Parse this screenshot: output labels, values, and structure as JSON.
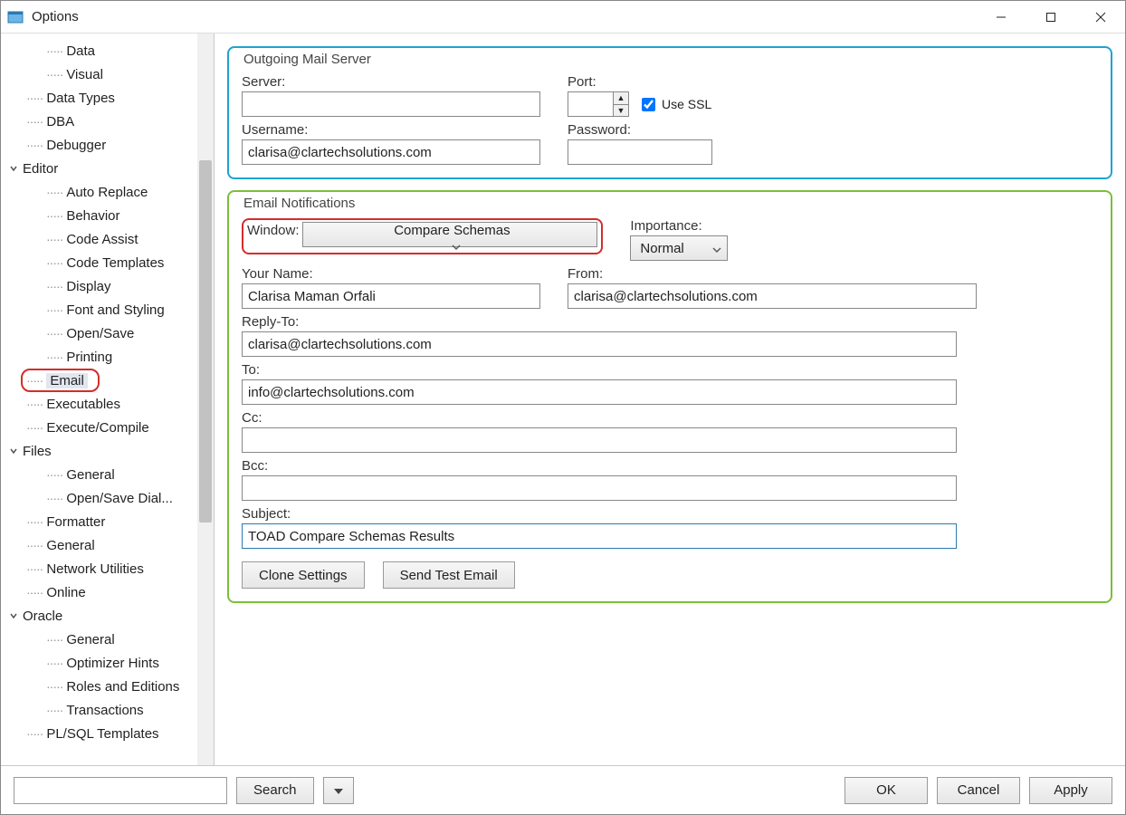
{
  "window": {
    "title": "Options"
  },
  "tree": {
    "items": [
      {
        "label": "Data",
        "indent": 3,
        "expander": ""
      },
      {
        "label": "Visual",
        "indent": 3,
        "expander": ""
      },
      {
        "label": "Data Types",
        "indent": 2,
        "expander": ""
      },
      {
        "label": "DBA",
        "indent": 2,
        "expander": ""
      },
      {
        "label": "Debugger",
        "indent": 2,
        "expander": ""
      },
      {
        "label": "Editor",
        "indent": 1,
        "expander": "open"
      },
      {
        "label": "Auto Replace",
        "indent": 3,
        "expander": ""
      },
      {
        "label": "Behavior",
        "indent": 3,
        "expander": ""
      },
      {
        "label": "Code Assist",
        "indent": 3,
        "expander": ""
      },
      {
        "label": "Code Templates",
        "indent": 3,
        "expander": ""
      },
      {
        "label": "Display",
        "indent": 3,
        "expander": ""
      },
      {
        "label": "Font and Styling",
        "indent": 3,
        "expander": ""
      },
      {
        "label": "Open/Save",
        "indent": 3,
        "expander": ""
      },
      {
        "label": "Printing",
        "indent": 3,
        "expander": ""
      },
      {
        "label": "Email",
        "indent": 2,
        "expander": "",
        "selected": true,
        "redbox": true
      },
      {
        "label": "Executables",
        "indent": 2,
        "expander": ""
      },
      {
        "label": "Execute/Compile",
        "indent": 2,
        "expander": ""
      },
      {
        "label": "Files",
        "indent": 1,
        "expander": "open"
      },
      {
        "label": "General",
        "indent": 3,
        "expander": ""
      },
      {
        "label": "Open/Save Dial...",
        "indent": 3,
        "expander": ""
      },
      {
        "label": "Formatter",
        "indent": 2,
        "expander": ""
      },
      {
        "label": "General",
        "indent": 2,
        "expander": ""
      },
      {
        "label": "Network Utilities",
        "indent": 2,
        "expander": ""
      },
      {
        "label": "Online",
        "indent": 2,
        "expander": ""
      },
      {
        "label": "Oracle",
        "indent": 1,
        "expander": "open"
      },
      {
        "label": "General",
        "indent": 3,
        "expander": ""
      },
      {
        "label": "Optimizer Hints",
        "indent": 3,
        "expander": ""
      },
      {
        "label": "Roles and Editions",
        "indent": 3,
        "expander": ""
      },
      {
        "label": "Transactions",
        "indent": 3,
        "expander": ""
      },
      {
        "label": "PL/SQL Templates",
        "indent": 2,
        "expander": ""
      }
    ]
  },
  "outgoing": {
    "title": "Outgoing Mail Server",
    "server_label": "Server:",
    "server_value": "",
    "port_label": "Port:",
    "port_value": "",
    "use_ssl_label": "Use SSL",
    "use_ssl_checked": true,
    "username_label": "Username:",
    "username_value": "clarisa@clartechsolutions.com",
    "password_label": "Password:",
    "password_value": ""
  },
  "notifications": {
    "title": "Email Notifications",
    "window_label": "Window:",
    "window_value": "Compare Schemas",
    "importance_label": "Importance:",
    "importance_value": "Normal",
    "yourname_label": "Your Name:",
    "yourname_value": "Clarisa Maman Orfali",
    "from_label": "From:",
    "from_value": "clarisa@clartechsolutions.com",
    "replyto_label": "Reply-To:",
    "replyto_value": "clarisa@clartechsolutions.com",
    "to_label": "To:",
    "to_value": "info@clartechsolutions.com",
    "cc_label": "Cc:",
    "cc_value": "",
    "bcc_label": "Bcc:",
    "bcc_value": "",
    "subject_label": "Subject:",
    "subject_value": "TOAD Compare Schemas Results",
    "clone_button": "Clone Settings",
    "sendtest_button": "Send Test Email"
  },
  "bottom": {
    "search_placeholder": "",
    "search_button": "Search",
    "ok_button": "OK",
    "cancel_button": "Cancel",
    "apply_button": "Apply"
  }
}
